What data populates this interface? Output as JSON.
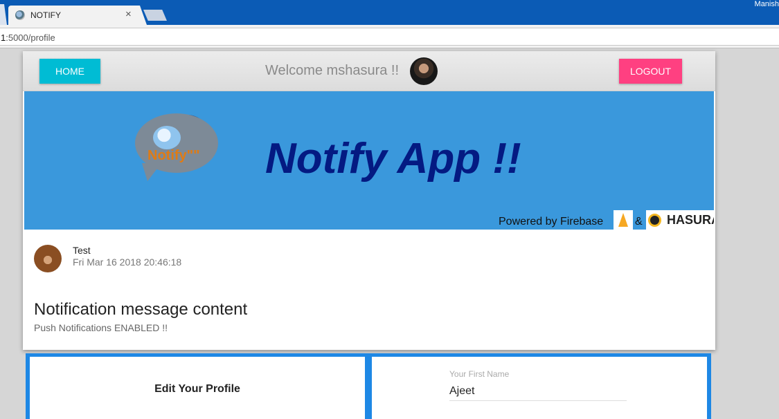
{
  "browser": {
    "user_name": "Manish",
    "tab_title": "NOTIFY",
    "tab_close": "×",
    "url_prefix": "1",
    "url_rest": ":5000/profile"
  },
  "header": {
    "home_label": "HOME",
    "welcome_text": "Welcome mshasura !!",
    "logout_label": "LOGOUT"
  },
  "banner": {
    "logo_text": "Notify\"\"",
    "title": "Notify App !!",
    "powered_text": "Powered by Firebase",
    "amp": "&",
    "hasura_text": "HASURA"
  },
  "notification": {
    "title": "Test",
    "timestamp": "Fri Mar 16 2018 20:46:18",
    "heading": "Notification message content",
    "status": "Push Notifications ENABLED !!"
  },
  "profile": {
    "edit_title": "Edit Your Profile",
    "first_name_label": "Your First Name",
    "first_name_value": "Ajeet"
  },
  "colors": {
    "home_button": "#00bcd4",
    "logout_button": "#ff4081",
    "banner_bg": "#3a98dc",
    "banner_title": "#041a82",
    "panel_accent": "#1e88e5"
  }
}
